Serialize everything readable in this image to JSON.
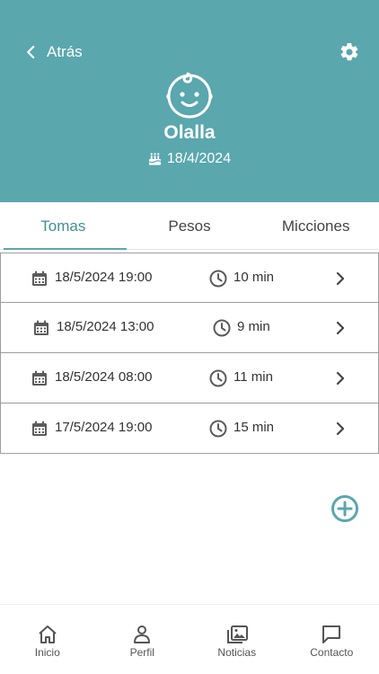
{
  "header": {
    "back_label": "Atrás",
    "baby_name": "Olalla",
    "birth_date": "18/4/2024",
    "background_color": "#5aa7ae"
  },
  "tabs": [
    {
      "label": "Tomas",
      "active": true
    },
    {
      "label": "Pesos",
      "active": false
    },
    {
      "label": "Micciones",
      "active": false
    }
  ],
  "feedings": [
    {
      "datetime": "18/5/2024 19:00",
      "duration": "10 min"
    },
    {
      "datetime": "18/5/2024 13:00",
      "duration": "9 min"
    },
    {
      "datetime": "18/5/2024 08:00",
      "duration": "11 min"
    },
    {
      "datetime": "17/5/2024 19:00",
      "duration": "15 min"
    }
  ],
  "icons": {
    "back": "chevron-left-icon",
    "settings": "gear-icon",
    "avatar": "baby-face-icon",
    "birthday": "cake-icon",
    "date": "calendar-icon",
    "time": "clock-icon",
    "open": "chevron-right-icon",
    "add": "plus-circle-icon"
  },
  "bottom_nav": [
    {
      "label": "Inicio",
      "icon": "home-icon"
    },
    {
      "label": "Perfil",
      "icon": "person-icon"
    },
    {
      "label": "Noticias",
      "icon": "gallery-icon"
    },
    {
      "label": "Contacto",
      "icon": "chat-icon"
    }
  ],
  "accent_color": "#5aa7ae"
}
